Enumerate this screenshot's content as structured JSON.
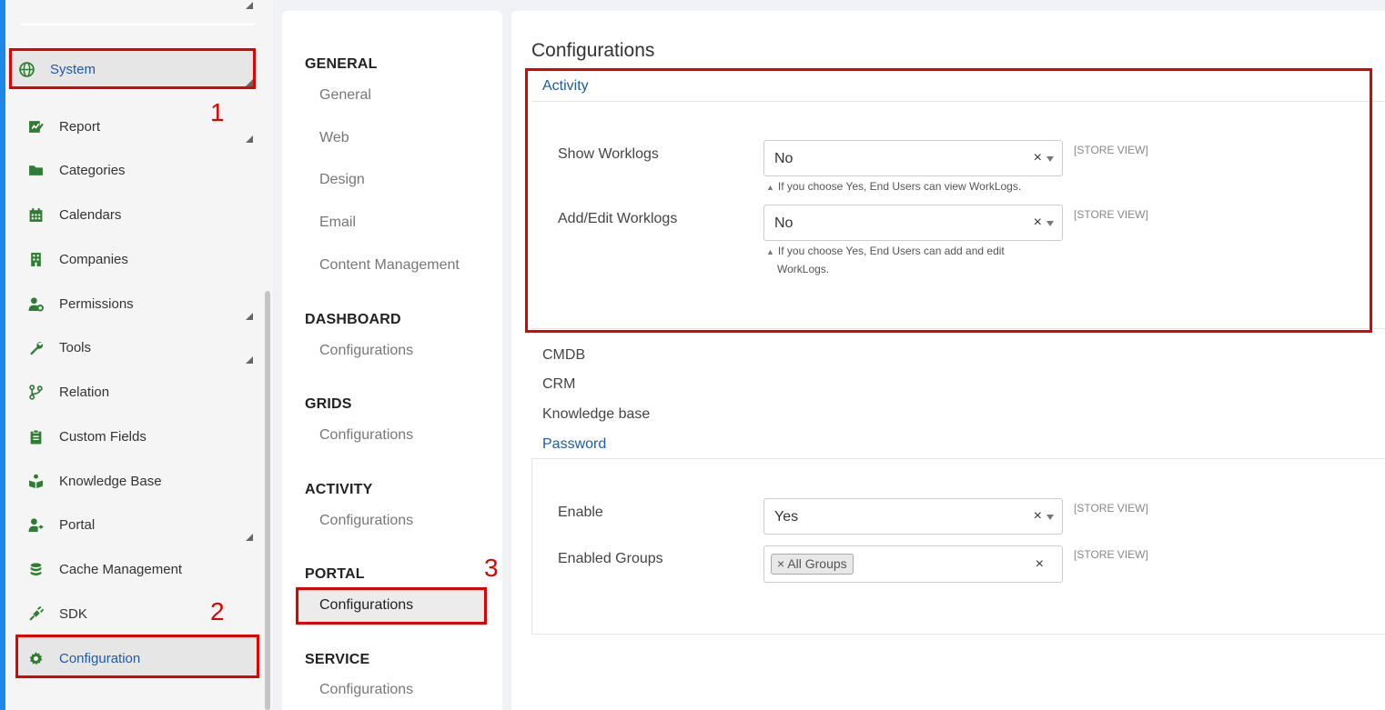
{
  "sidebar": {
    "system_label": "System",
    "items": [
      {
        "label": "Report",
        "icon": "report-icon"
      },
      {
        "label": "Categories",
        "icon": "folder-icon"
      },
      {
        "label": "Calendars",
        "icon": "calendar-icon"
      },
      {
        "label": "Companies",
        "icon": "building-icon"
      },
      {
        "label": "Permissions",
        "icon": "user-gear-icon"
      },
      {
        "label": "Tools",
        "icon": "wrench-icon"
      },
      {
        "label": "Relation",
        "icon": "branch-icon"
      },
      {
        "label": "Custom Fields",
        "icon": "clipboard-icon"
      },
      {
        "label": "Knowledge Base",
        "icon": "book-reader-icon"
      },
      {
        "label": "Portal",
        "icon": "user-share-icon"
      },
      {
        "label": "Cache Management",
        "icon": "database-icon"
      },
      {
        "label": "SDK",
        "icon": "plug-icon"
      },
      {
        "label": "Configuration",
        "icon": "gear-icon"
      }
    ],
    "accent_color": "#1e88e5",
    "active_color": "#1f5aa6"
  },
  "annotations": {
    "step1": "1",
    "step2": "2",
    "step3": "3",
    "box_color": "#e30000"
  },
  "sections": {
    "general": {
      "title": "GENERAL",
      "items": [
        "General",
        "Web",
        "Design",
        "Email",
        "Content Management"
      ]
    },
    "dashboard": {
      "title": "DASHBOARD",
      "items": [
        "Configurations"
      ]
    },
    "grids": {
      "title": "GRIDS",
      "items": [
        "Configurations"
      ]
    },
    "activity": {
      "title": "ACTIVITY",
      "items": [
        "Configurations"
      ]
    },
    "portal": {
      "title": "PORTAL",
      "items": [
        "Configurations"
      ]
    },
    "service": {
      "title": "SERVICE",
      "items": [
        "Configurations"
      ]
    }
  },
  "main": {
    "title": "Configurations",
    "activity": {
      "header": "Activity",
      "show_worklogs": {
        "label": "Show Worklogs",
        "value": "No",
        "clear": "×",
        "scope": "[STORE VIEW]",
        "note": "If you choose Yes, End Users can view WorkLogs."
      },
      "add_edit_worklogs": {
        "label": "Add/Edit Worklogs",
        "value": "No",
        "clear": "×",
        "scope": "[STORE VIEW]",
        "note_line1": "If you choose Yes, End Users can add and edit",
        "note_line2": "WorkLogs."
      }
    },
    "collapsed_groups": [
      "CMDB",
      "CRM",
      "Knowledge base"
    ],
    "password": {
      "header": "Password",
      "enable": {
        "label": "Enable",
        "value": "Yes",
        "clear": "×",
        "scope": "[STORE VIEW]"
      },
      "enabled_groups": {
        "label": "Enabled Groups",
        "chip": "× All Groups",
        "clear": "×",
        "scope": "[STORE VIEW]"
      }
    }
  }
}
